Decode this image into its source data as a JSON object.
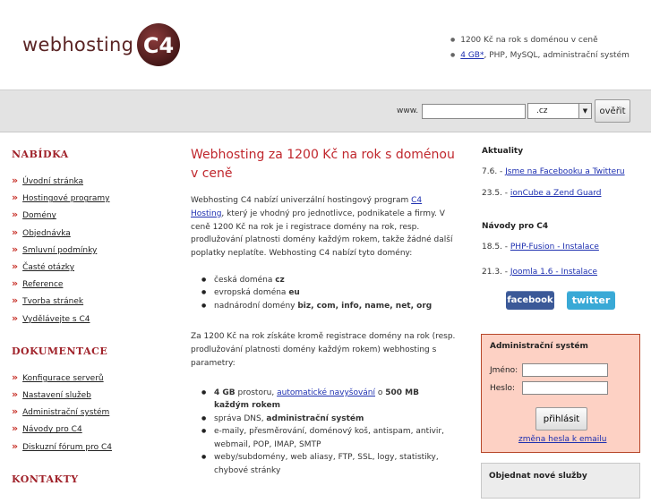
{
  "header": {
    "logo_text": "webhosting",
    "logo_badge": "C4",
    "bullet1": "1200 Kč na rok s doménou v ceně",
    "bullet2_link": "4 GB*",
    "bullet2_rest": ", PHP, MySQL, administrační systém"
  },
  "domain_bar": {
    "www_label": "www.",
    "input_value": "",
    "tld_selected": ".cz",
    "check_button": "ověřit"
  },
  "nav": {
    "sections": [
      {
        "title": "NABÍDKA",
        "items": [
          "Úvodní stránka",
          "Hostingové programy",
          "Domény",
          "Objednávka",
          "Smluvní podmínky",
          "Časté otázky",
          "Reference",
          "Tvorba stránek",
          "Vydělávejte s C4"
        ]
      },
      {
        "title": "DOKUMENTACE",
        "items": [
          "Konfigurace serverů",
          "Nastavení služeb",
          "Administrační systém",
          "Návody pro C4",
          "Diskuzní fórum pro C4"
        ]
      },
      {
        "title": "KONTAKTY",
        "items": []
      }
    ]
  },
  "main": {
    "title": "Webhosting za 1200 Kč na rok s doménou v ceně",
    "p1_a": "Webhosting C4 nabízí univerzální hostingový program ",
    "p1_link": "C4 Hosting",
    "p1_b": ", který je vhodný pro jednotlivce, podnikatele a firmy. V ceně 1200 Kč na rok je i registrace domény na rok, resp. prodlužování platnosti domény každým rokem, takže žádné další poplatky neplatíte. Webhosting C4 nabízí tyto domény:",
    "domains": [
      {
        "text": "česká doména ",
        "bold": "cz"
      },
      {
        "text": "evropská doména ",
        "bold": "eu"
      },
      {
        "text": "nadnárodní domény ",
        "bold": "biz, com, info, name, net, org"
      }
    ],
    "p2": "Za 1200 Kč na rok získáte kromě registrace domény na rok (resp. prodlužování platnosti domény každým rokem) webhosting s parametry:",
    "features": {
      "f1_bold": "4 GB",
      "f1_text": " prostoru, ",
      "f1_link": "automatické navyšování",
      "f1_text2": " o ",
      "f1_bold2": "500 MB každým rokem",
      "f2_text": "správa DNS, ",
      "f2_bold": "administrační systém",
      "f3": "e-maily, přesměrování, doménový koš, antispam, antivir, webmail, POP, IMAP, SMTP",
      "f4": "weby/subdomény, web aliasy, FTP, SSL, logy, statistiky, chybové stránky"
    }
  },
  "right": {
    "news_title": "Aktuality",
    "news": [
      {
        "date": "7.6. - ",
        "link": "Jsme na Facebooku a Twitteru"
      },
      {
        "date": "23.5. - ",
        "link": "ionCube a Zend Guard"
      }
    ],
    "guides_title": "Návody pro C4",
    "guides": [
      {
        "date": "18.5. - ",
        "link": "PHP-Fusion - Instalace"
      },
      {
        "date": "21.3. - ",
        "link": "Joomla 1.6 - Instalace"
      }
    ],
    "facebook": "facebook",
    "twitter": "twitter",
    "login": {
      "title": "Administrační systém",
      "name_label": "Jméno:",
      "pass_label": "Heslo:",
      "submit": "přihlásit",
      "change_link": "změna hesla k emailu"
    },
    "order_title": "Objednat nové služby"
  },
  "colors": {
    "accent_red": "#c0272d",
    "link_blue": "#1d2fb0",
    "login_bg": "#fdd1c4",
    "logo_brown": "#5a2424"
  }
}
